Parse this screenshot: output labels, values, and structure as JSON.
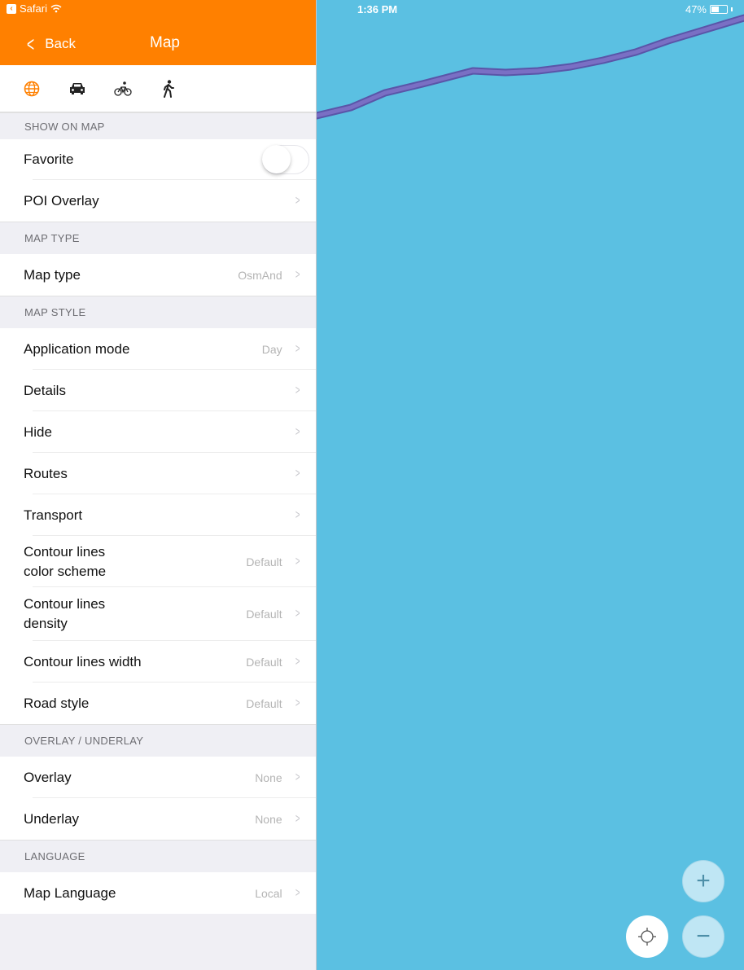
{
  "status_bar": {
    "back_app": "Safari",
    "time": "1:36 PM",
    "battery": "47%"
  },
  "nav": {
    "back_label": "Back",
    "title": "Map"
  },
  "tabs": [
    {
      "icon": "globe-icon",
      "active": true
    },
    {
      "icon": "car-icon",
      "active": false
    },
    {
      "icon": "bicycle-icon",
      "active": false
    },
    {
      "icon": "pedestrian-icon",
      "active": false
    }
  ],
  "sections": {
    "show_on_map": {
      "header": "SHOW ON MAP",
      "favorite": "Favorite",
      "poi_overlay": "POI Overlay"
    },
    "map_type": {
      "header": "MAP TYPE",
      "map_type": {
        "label": "Map type",
        "value": "OsmAnd"
      }
    },
    "map_style": {
      "header": "MAP STYLE",
      "items": [
        {
          "label": "Application mode",
          "value": "Day"
        },
        {
          "label": "Details",
          "value": ""
        },
        {
          "label": "Hide",
          "value": ""
        },
        {
          "label": "Routes",
          "value": ""
        },
        {
          "label": "Transport",
          "value": ""
        },
        {
          "label": "Contour lines color scheme",
          "value": "Default"
        },
        {
          "label": "Contour lines density",
          "value": "Default"
        },
        {
          "label": "Contour lines width",
          "value": "Default"
        },
        {
          "label": "Road style",
          "value": "Default"
        }
      ]
    },
    "overlay_underlay": {
      "header": "OVERLAY / UNDERLAY",
      "items": [
        {
          "label": "Overlay",
          "value": "None"
        },
        {
          "label": "Underlay",
          "value": "None"
        }
      ]
    },
    "language": {
      "header": "LANGUAGE",
      "map_language": {
        "label": "Map Language",
        "value": "Local"
      }
    }
  },
  "controls": {
    "zoom_in": "+",
    "zoom_out": "−"
  },
  "colors": {
    "accent": "#ff8000",
    "water": "#5bc0e2",
    "route": "#7a6fc4"
  },
  "favorite_toggle_on": false
}
